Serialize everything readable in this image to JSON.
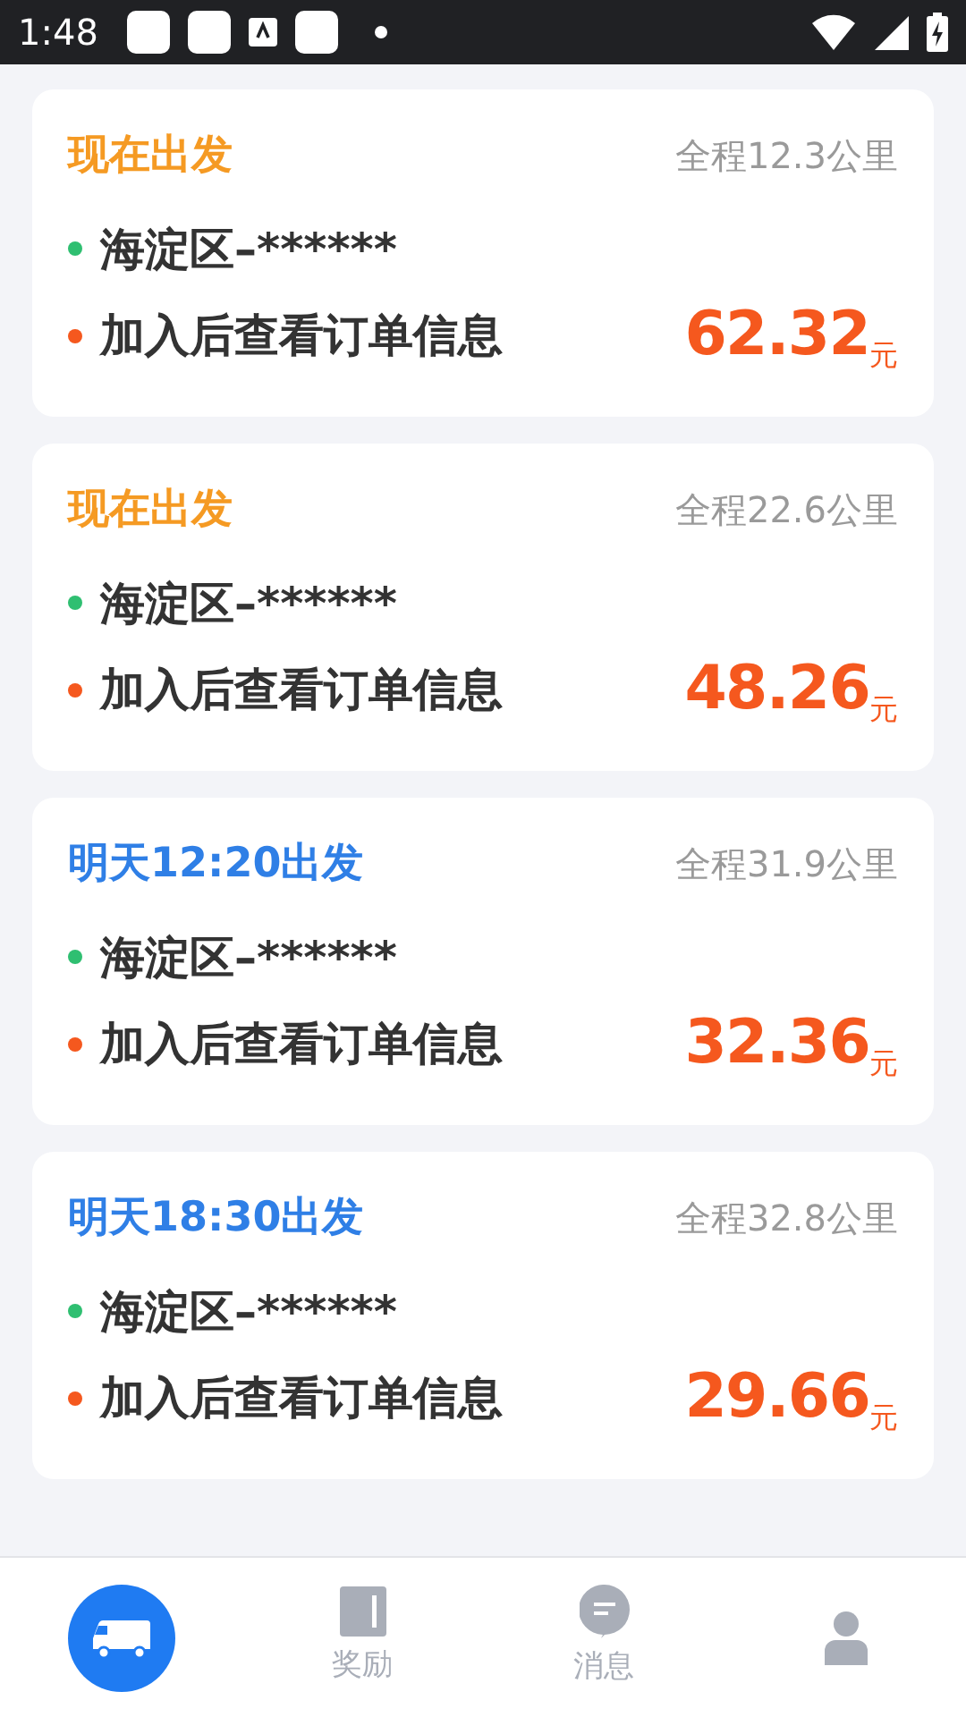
{
  "status_bar": {
    "time": "1:48"
  },
  "orders": [
    {
      "departure": "现在出发",
      "color": "#f59a23",
      "distance": "全程12.3公里",
      "origin": "海淀区–******",
      "destination": "加入后查看订单信息",
      "price": "62.32",
      "unit": "元"
    },
    {
      "departure": "现在出发",
      "color": "#f59a23",
      "distance": "全程22.6公里",
      "origin": "海淀区–******",
      "destination": "加入后查看订单信息",
      "price": "48.26",
      "unit": "元"
    },
    {
      "departure": "明天12:20出发",
      "color": "#2f7fe6",
      "distance": "全程31.9公里",
      "origin": "海淀区–******",
      "destination": "加入后查看订单信息",
      "price": "32.36",
      "unit": "元"
    },
    {
      "departure": "明天18:30出发",
      "color": "#2f7fe6",
      "distance": "全程32.8公里",
      "origin": "海淀区–******",
      "destination": "加入后查看订单信息",
      "price": "29.66",
      "unit": "元"
    }
  ],
  "tabs": [
    {
      "kind": "truck",
      "selected": true
    },
    {
      "kind": "book",
      "label": "奖励",
      "selected": false
    },
    {
      "kind": "chat",
      "label": "消息",
      "selected": false
    },
    {
      "kind": "person",
      "selected": false
    }
  ]
}
